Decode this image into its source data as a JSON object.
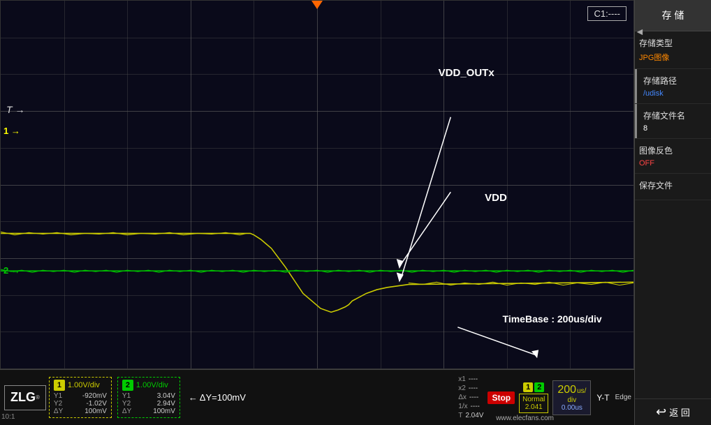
{
  "screen": {
    "c1_label": "C1:----",
    "t_marker": "T →",
    "ch1_marker_symbol": "1",
    "ch2_marker_symbol": "2",
    "vdd_outx_label": "VDD_OUTx",
    "vdd_label": "VDD",
    "timebase_label": "TimeBase : 200us/div"
  },
  "status_bar": {
    "zlg": "ZLG",
    "ch1": {
      "badge": "1",
      "scale": "1.00V/div",
      "y1_label": "Y1",
      "y1_val": "-920mV",
      "y2_label": "Y2",
      "y2_val": "-1.02V",
      "dy_label": "ΔY",
      "dy_val": "100mV"
    },
    "ch2": {
      "badge": "2",
      "scale": "1.00V/div",
      "y1_label": "Y1",
      "y1_val": "3.04V",
      "y2_label": "Y2",
      "y2_val": "2.94V",
      "dy_label": "ΔY",
      "dy_val": "100mV"
    },
    "delta_label": "← ΔY=100mV",
    "meas": {
      "x1": "x1",
      "x1_val": "----",
      "x2": "x2",
      "x2_val": "----",
      "dx": "Δx",
      "dx_val": "----",
      "one_x": "1/x",
      "one_x_val": "----",
      "t_label": "T",
      "t_val": "2.04V"
    },
    "stop": "Stop",
    "normal_line1": "Normal",
    "normal_line2": "2.041",
    "time_val": "200",
    "time_unit": "us/",
    "time_div": "div",
    "time_offset": "0.00us",
    "yt": "Y-T",
    "edge_label": "Edge",
    "website": "www.elecfans.com"
  },
  "right_panel": {
    "save_label": "存 储",
    "type_title": "存储类型",
    "type_value": "JPG图像",
    "path_title": "存储路径",
    "path_value": "/udisk",
    "filename_title": "存储文件名",
    "filename_value": "8",
    "invert_title": "图像反色",
    "invert_value": "OFF",
    "save_file_label": "保存文件",
    "back_label": "返 回"
  }
}
